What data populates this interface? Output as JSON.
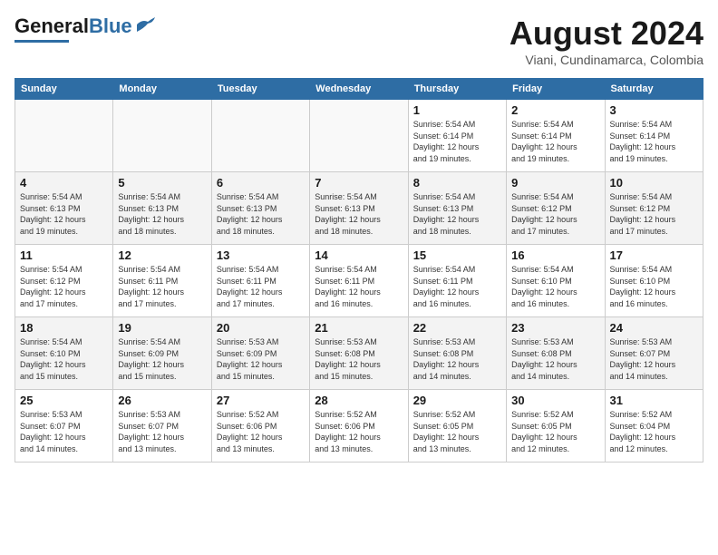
{
  "header": {
    "logo_general": "General",
    "logo_blue": "Blue",
    "month_year": "August 2024",
    "location": "Viani, Cundinamarca, Colombia"
  },
  "days_of_week": [
    "Sunday",
    "Monday",
    "Tuesday",
    "Wednesday",
    "Thursday",
    "Friday",
    "Saturday"
  ],
  "weeks": [
    [
      {
        "day": "",
        "info": ""
      },
      {
        "day": "",
        "info": ""
      },
      {
        "day": "",
        "info": ""
      },
      {
        "day": "",
        "info": ""
      },
      {
        "day": "1",
        "info": "Sunrise: 5:54 AM\nSunset: 6:14 PM\nDaylight: 12 hours\nand 19 minutes."
      },
      {
        "day": "2",
        "info": "Sunrise: 5:54 AM\nSunset: 6:14 PM\nDaylight: 12 hours\nand 19 minutes."
      },
      {
        "day": "3",
        "info": "Sunrise: 5:54 AM\nSunset: 6:14 PM\nDaylight: 12 hours\nand 19 minutes."
      }
    ],
    [
      {
        "day": "4",
        "info": "Sunrise: 5:54 AM\nSunset: 6:13 PM\nDaylight: 12 hours\nand 19 minutes."
      },
      {
        "day": "5",
        "info": "Sunrise: 5:54 AM\nSunset: 6:13 PM\nDaylight: 12 hours\nand 18 minutes."
      },
      {
        "day": "6",
        "info": "Sunrise: 5:54 AM\nSunset: 6:13 PM\nDaylight: 12 hours\nand 18 minutes."
      },
      {
        "day": "7",
        "info": "Sunrise: 5:54 AM\nSunset: 6:13 PM\nDaylight: 12 hours\nand 18 minutes."
      },
      {
        "day": "8",
        "info": "Sunrise: 5:54 AM\nSunset: 6:13 PM\nDaylight: 12 hours\nand 18 minutes."
      },
      {
        "day": "9",
        "info": "Sunrise: 5:54 AM\nSunset: 6:12 PM\nDaylight: 12 hours\nand 17 minutes."
      },
      {
        "day": "10",
        "info": "Sunrise: 5:54 AM\nSunset: 6:12 PM\nDaylight: 12 hours\nand 17 minutes."
      }
    ],
    [
      {
        "day": "11",
        "info": "Sunrise: 5:54 AM\nSunset: 6:12 PM\nDaylight: 12 hours\nand 17 minutes."
      },
      {
        "day": "12",
        "info": "Sunrise: 5:54 AM\nSunset: 6:11 PM\nDaylight: 12 hours\nand 17 minutes."
      },
      {
        "day": "13",
        "info": "Sunrise: 5:54 AM\nSunset: 6:11 PM\nDaylight: 12 hours\nand 17 minutes."
      },
      {
        "day": "14",
        "info": "Sunrise: 5:54 AM\nSunset: 6:11 PM\nDaylight: 12 hours\nand 16 minutes."
      },
      {
        "day": "15",
        "info": "Sunrise: 5:54 AM\nSunset: 6:11 PM\nDaylight: 12 hours\nand 16 minutes."
      },
      {
        "day": "16",
        "info": "Sunrise: 5:54 AM\nSunset: 6:10 PM\nDaylight: 12 hours\nand 16 minutes."
      },
      {
        "day": "17",
        "info": "Sunrise: 5:54 AM\nSunset: 6:10 PM\nDaylight: 12 hours\nand 16 minutes."
      }
    ],
    [
      {
        "day": "18",
        "info": "Sunrise: 5:54 AM\nSunset: 6:10 PM\nDaylight: 12 hours\nand 15 minutes."
      },
      {
        "day": "19",
        "info": "Sunrise: 5:54 AM\nSunset: 6:09 PM\nDaylight: 12 hours\nand 15 minutes."
      },
      {
        "day": "20",
        "info": "Sunrise: 5:53 AM\nSunset: 6:09 PM\nDaylight: 12 hours\nand 15 minutes."
      },
      {
        "day": "21",
        "info": "Sunrise: 5:53 AM\nSunset: 6:08 PM\nDaylight: 12 hours\nand 15 minutes."
      },
      {
        "day": "22",
        "info": "Sunrise: 5:53 AM\nSunset: 6:08 PM\nDaylight: 12 hours\nand 14 minutes."
      },
      {
        "day": "23",
        "info": "Sunrise: 5:53 AM\nSunset: 6:08 PM\nDaylight: 12 hours\nand 14 minutes."
      },
      {
        "day": "24",
        "info": "Sunrise: 5:53 AM\nSunset: 6:07 PM\nDaylight: 12 hours\nand 14 minutes."
      }
    ],
    [
      {
        "day": "25",
        "info": "Sunrise: 5:53 AM\nSunset: 6:07 PM\nDaylight: 12 hours\nand 14 minutes."
      },
      {
        "day": "26",
        "info": "Sunrise: 5:53 AM\nSunset: 6:07 PM\nDaylight: 12 hours\nand 13 minutes."
      },
      {
        "day": "27",
        "info": "Sunrise: 5:52 AM\nSunset: 6:06 PM\nDaylight: 12 hours\nand 13 minutes."
      },
      {
        "day": "28",
        "info": "Sunrise: 5:52 AM\nSunset: 6:06 PM\nDaylight: 12 hours\nand 13 minutes."
      },
      {
        "day": "29",
        "info": "Sunrise: 5:52 AM\nSunset: 6:05 PM\nDaylight: 12 hours\nand 13 minutes."
      },
      {
        "day": "30",
        "info": "Sunrise: 5:52 AM\nSunset: 6:05 PM\nDaylight: 12 hours\nand 12 minutes."
      },
      {
        "day": "31",
        "info": "Sunrise: 5:52 AM\nSunset: 6:04 PM\nDaylight: 12 hours\nand 12 minutes."
      }
    ]
  ]
}
